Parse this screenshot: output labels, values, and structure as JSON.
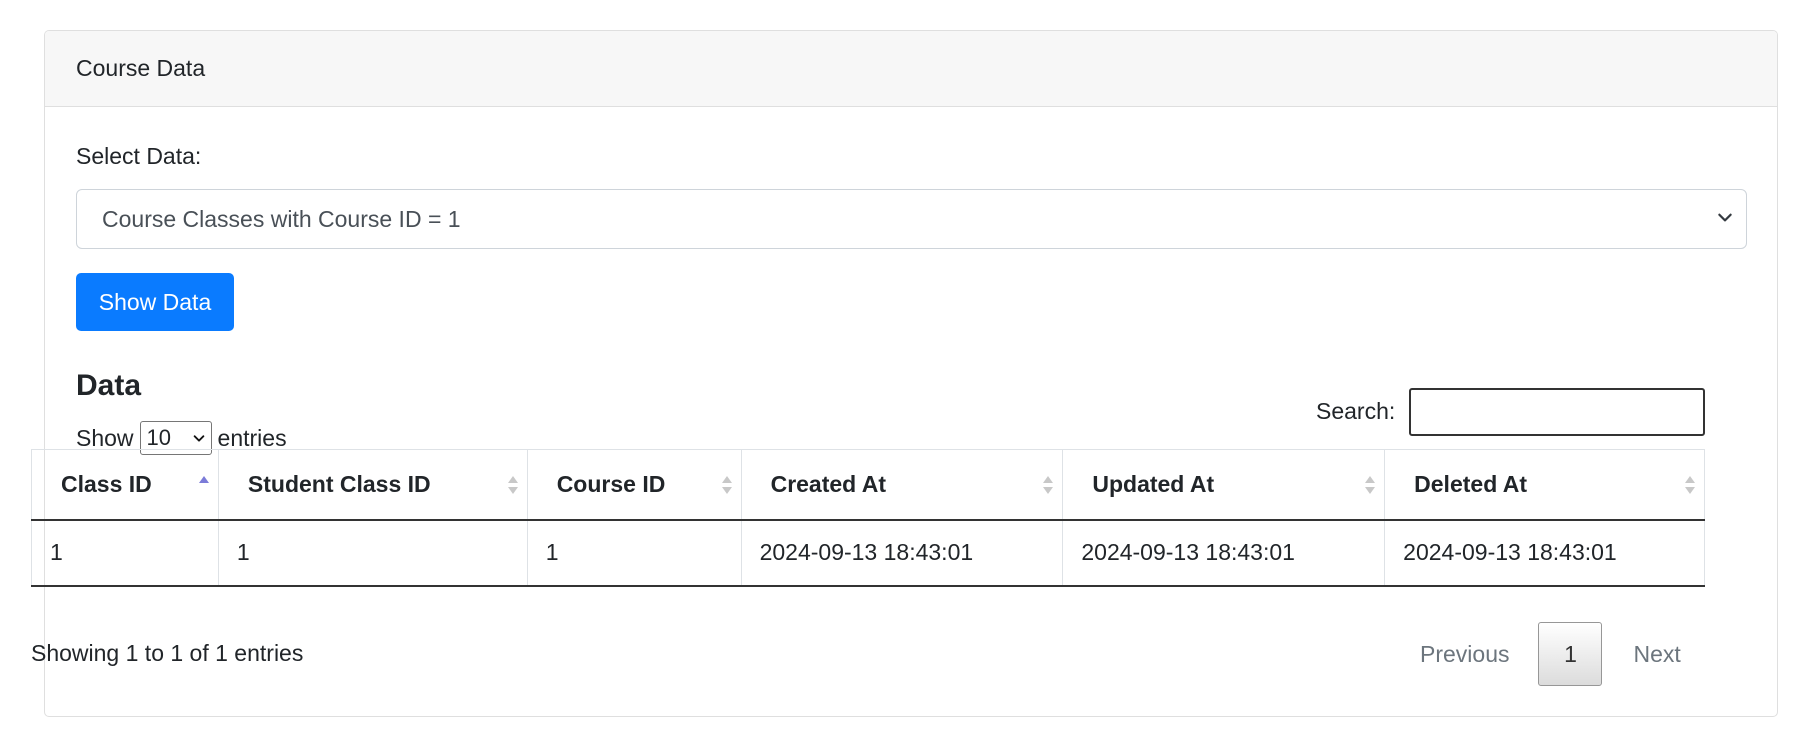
{
  "card": {
    "title": "Course Data"
  },
  "form": {
    "select_label": "Select Data:",
    "selected_option": "Course Classes with Course ID = 1",
    "button_label": "Show Data"
  },
  "data_section": {
    "title": "Data",
    "show_label": "Show",
    "entries_value": "10",
    "entries_label": "entries",
    "search_label": "Search:",
    "search_value": ""
  },
  "table": {
    "columns": [
      "Class ID",
      "Student Class ID",
      "Course ID",
      "Created At",
      "Updated At",
      "Deleted At"
    ],
    "rows": [
      [
        "1",
        "1",
        "1",
        "2024-09-13 18:43:01",
        "2024-09-13 18:43:01",
        "2024-09-13 18:43:01"
      ]
    ],
    "sorted_column": "Class ID",
    "sort_direction": "ascending"
  },
  "footer": {
    "info": "Showing 1 to 1 of 1 entries",
    "previous_label": "Previous",
    "current_page": "1",
    "next_label": "Next"
  },
  "colors": {
    "primary": "#0a7bff",
    "sort_active": "#7b7bd8",
    "sort_inactive": "#c8c8c8"
  }
}
